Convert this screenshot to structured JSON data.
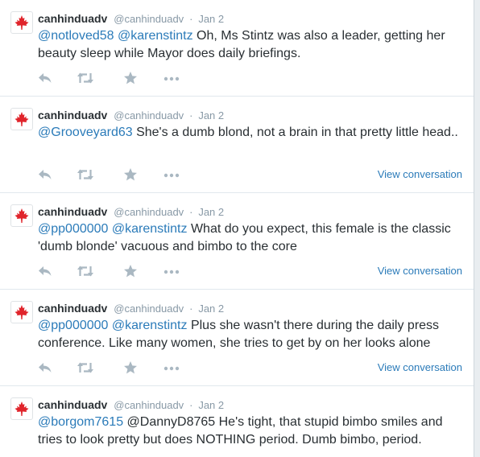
{
  "tweets": [
    {
      "name": "canhinduadv",
      "handle": "@canhinduadv",
      "separator": "·",
      "date": "Jan 2",
      "mention1": "@notloved58",
      "between": " ",
      "mention2": "@karenstintz",
      "body": " Oh, Ms Stintz was also a leader, getting her beauty sleep while Mayor does daily briefings.",
      "view_conversation": ""
    },
    {
      "name": "canhinduadv",
      "handle": "@canhinduadv",
      "separator": "·",
      "date": "Jan 2",
      "mention1": "@Grooveyard63",
      "between": "",
      "mention2": "",
      "body": " She's a dumb blond, not a brain in that pretty little head..",
      "view_conversation": "View conversation"
    },
    {
      "name": "canhinduadv",
      "handle": "@canhinduadv",
      "separator": "·",
      "date": "Jan 2",
      "mention1": "@pp000000",
      "between": " ",
      "mention2": "@karenstintz",
      "body": " What do you expect, this female is the classic 'dumb blonde' vacuous and bimbo to the core",
      "view_conversation": "View conversation"
    },
    {
      "name": "canhinduadv",
      "handle": "@canhinduadv",
      "separator": "·",
      "date": "Jan 2",
      "mention1": "@pp000000",
      "between": " ",
      "mention2": "@karenstintz",
      "body": " Plus she wasn't there during the daily press conference. Like many women, she tries to get by on her looks alone",
      "view_conversation": "View conversation"
    },
    {
      "name": "canhinduadv",
      "handle": "@canhinduadv",
      "separator": "·",
      "date": "Jan 2",
      "mention1": "@borgom7615",
      "between": "",
      "mention2": "",
      "body": " @DannyD8765 He's tight, that stupid bimbo smiles and tries to look pretty but does NOTHING period. Dumb bimbo, period.",
      "view_conversation": ""
    }
  ],
  "icons": {
    "avatar": "maple-leaf-icon",
    "reply": "reply-icon",
    "retweet": "retweet-icon",
    "favorite": "star-icon",
    "more": "more-icon"
  },
  "colors": {
    "link": "#2b7bb9",
    "text": "#292f33",
    "muted": "#8899a6",
    "icon": "#aab8c2",
    "maple": "#e0242b"
  }
}
